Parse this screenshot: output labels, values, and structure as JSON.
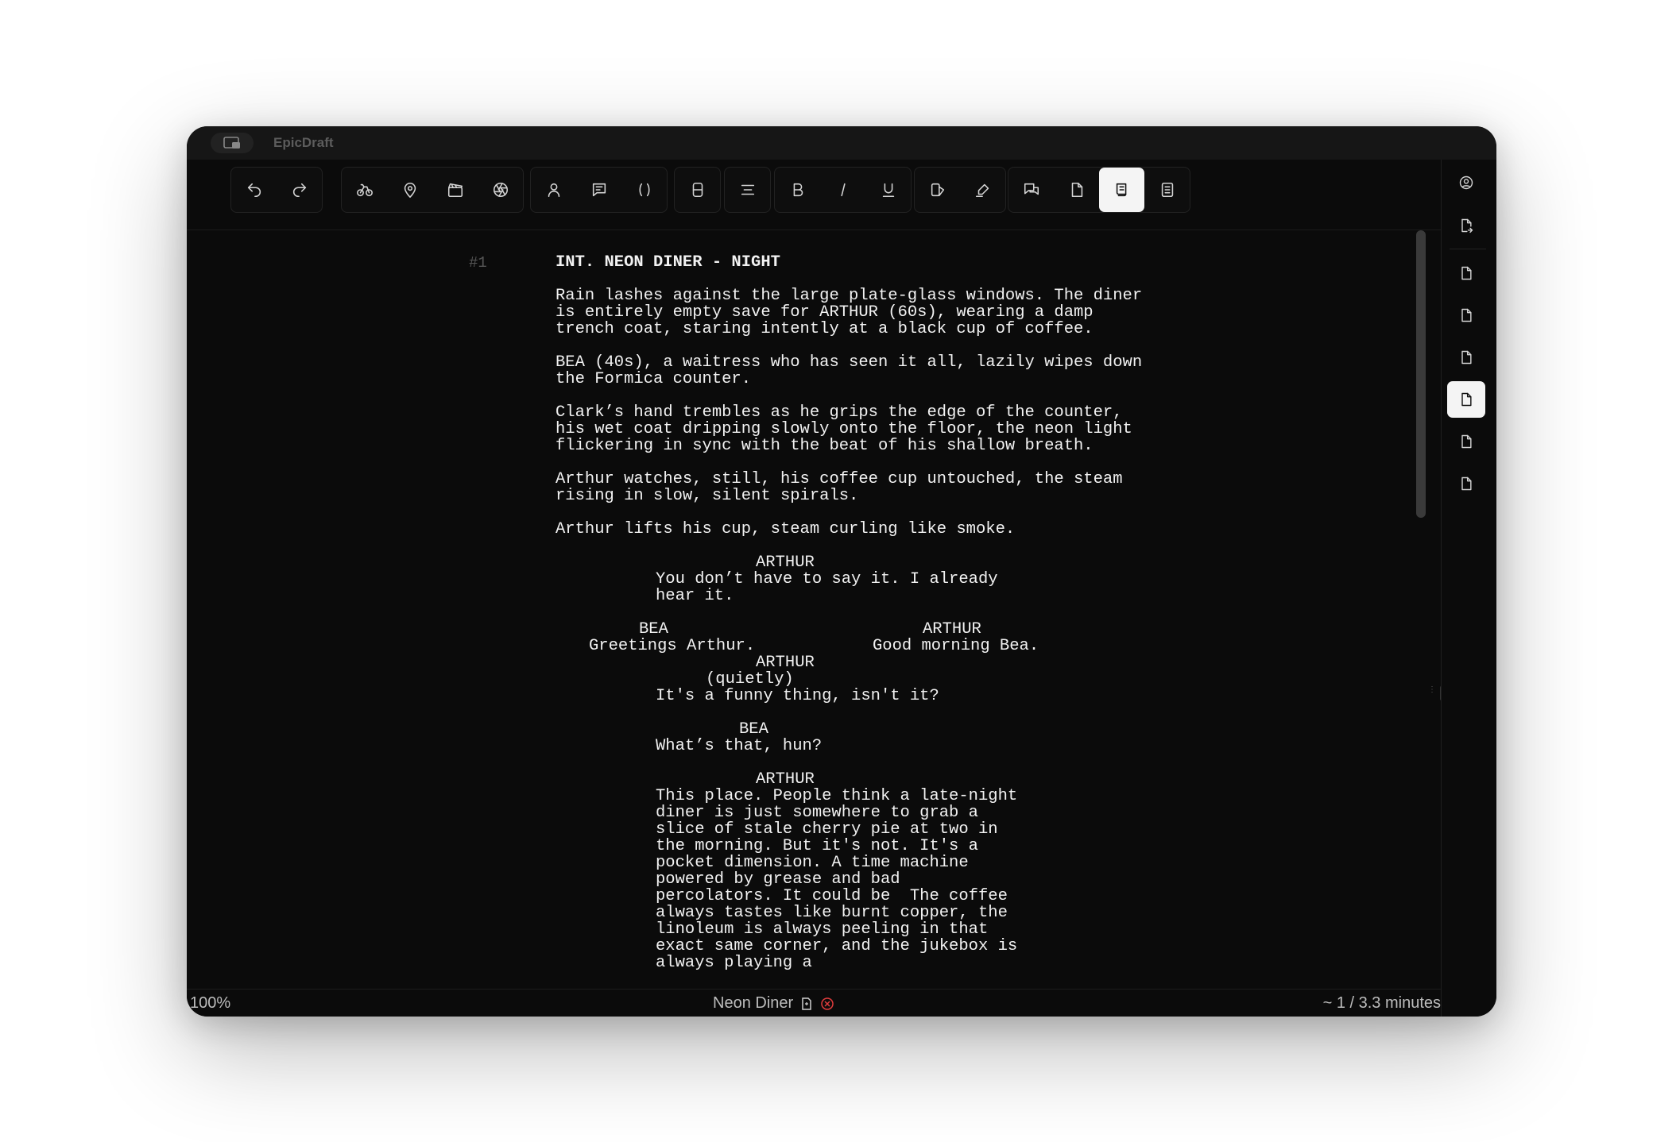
{
  "app": {
    "title": "EpicDraft"
  },
  "toolbar": {
    "groups": [
      [
        "undo-icon",
        "redo-icon"
      ],
      [
        "action-icon",
        "location-icon",
        "scene-clapper-icon",
        "camera-aperture-icon"
      ],
      [
        "character-icon",
        "dialogue-icon",
        "parenthetical-icon"
      ],
      [
        "dual-dialogue-icon"
      ],
      [
        "align-center-icon"
      ],
      [
        "bold-icon",
        "italic-icon",
        "underline-icon"
      ],
      [
        "highlight-icon",
        "signature-pen-icon"
      ],
      [
        "comments-icon",
        "page-icon",
        "script-view-icon",
        "outline-view-icon"
      ]
    ],
    "active": "script-view-icon"
  },
  "script": {
    "scene_number": "#1",
    "heading": "INT. NEON DINER - NIGHT",
    "action_1": "Rain lashes against the large plate-glass windows. The diner is entirely empty save for ARTHUR (60s), wearing a damp trench coat, staring intently at a black cup of coffee.",
    "action_2": "BEA (40s), a waitress who has seen it all, lazily wipes down the Formica counter.",
    "action_3": "Clark’s hand trembles as he grips the edge of the counter, his wet coat dripping slowly onto the floor, the neon light flickering in sync with the beat of his shallow breath.",
    "action_4": "Arthur watches, still, his coffee cup untouched, the steam rising in slow, silent spirals.",
    "action_5": "Arthur lifts his cup, steam curling like smoke.",
    "char_1": "ARTHUR",
    "dlg_1": "You don’t have to say it. I already hear it.",
    "dual_left_char": "BEA",
    "dual_left_line": "Greetings Arthur.",
    "dual_right_char": "ARTHUR",
    "dual_right_line": "Good morning Bea.",
    "char_2": "ARTHUR",
    "paren_2": "(quietly)",
    "dlg_2": "It's a funny thing, isn't it?",
    "char_3": "BEA",
    "dlg_3": "What’s that, hun?",
    "char_4": "ARTHUR",
    "dlg_4": "This place. People think a late-night diner is just somewhere to grab a slice of stale cherry pie at two in the morning. But it's not. It's a pocket dimension. A time machine powered by grease and bad percolators. It could be  The coffee always tastes like burnt copper, the linoleum is always peeling in that exact same corner, and the jukebox is always playing a"
  },
  "status": {
    "zoom": "100%",
    "document": "Neon Diner",
    "duration": "~ 1 / 3.3 minutes"
  },
  "sidebar": {
    "items": [
      "user-icon",
      "export-icon",
      "page-icon",
      "page-icon",
      "page-icon",
      "page-icon",
      "page-icon",
      "page-icon"
    ],
    "active_index": 5
  }
}
